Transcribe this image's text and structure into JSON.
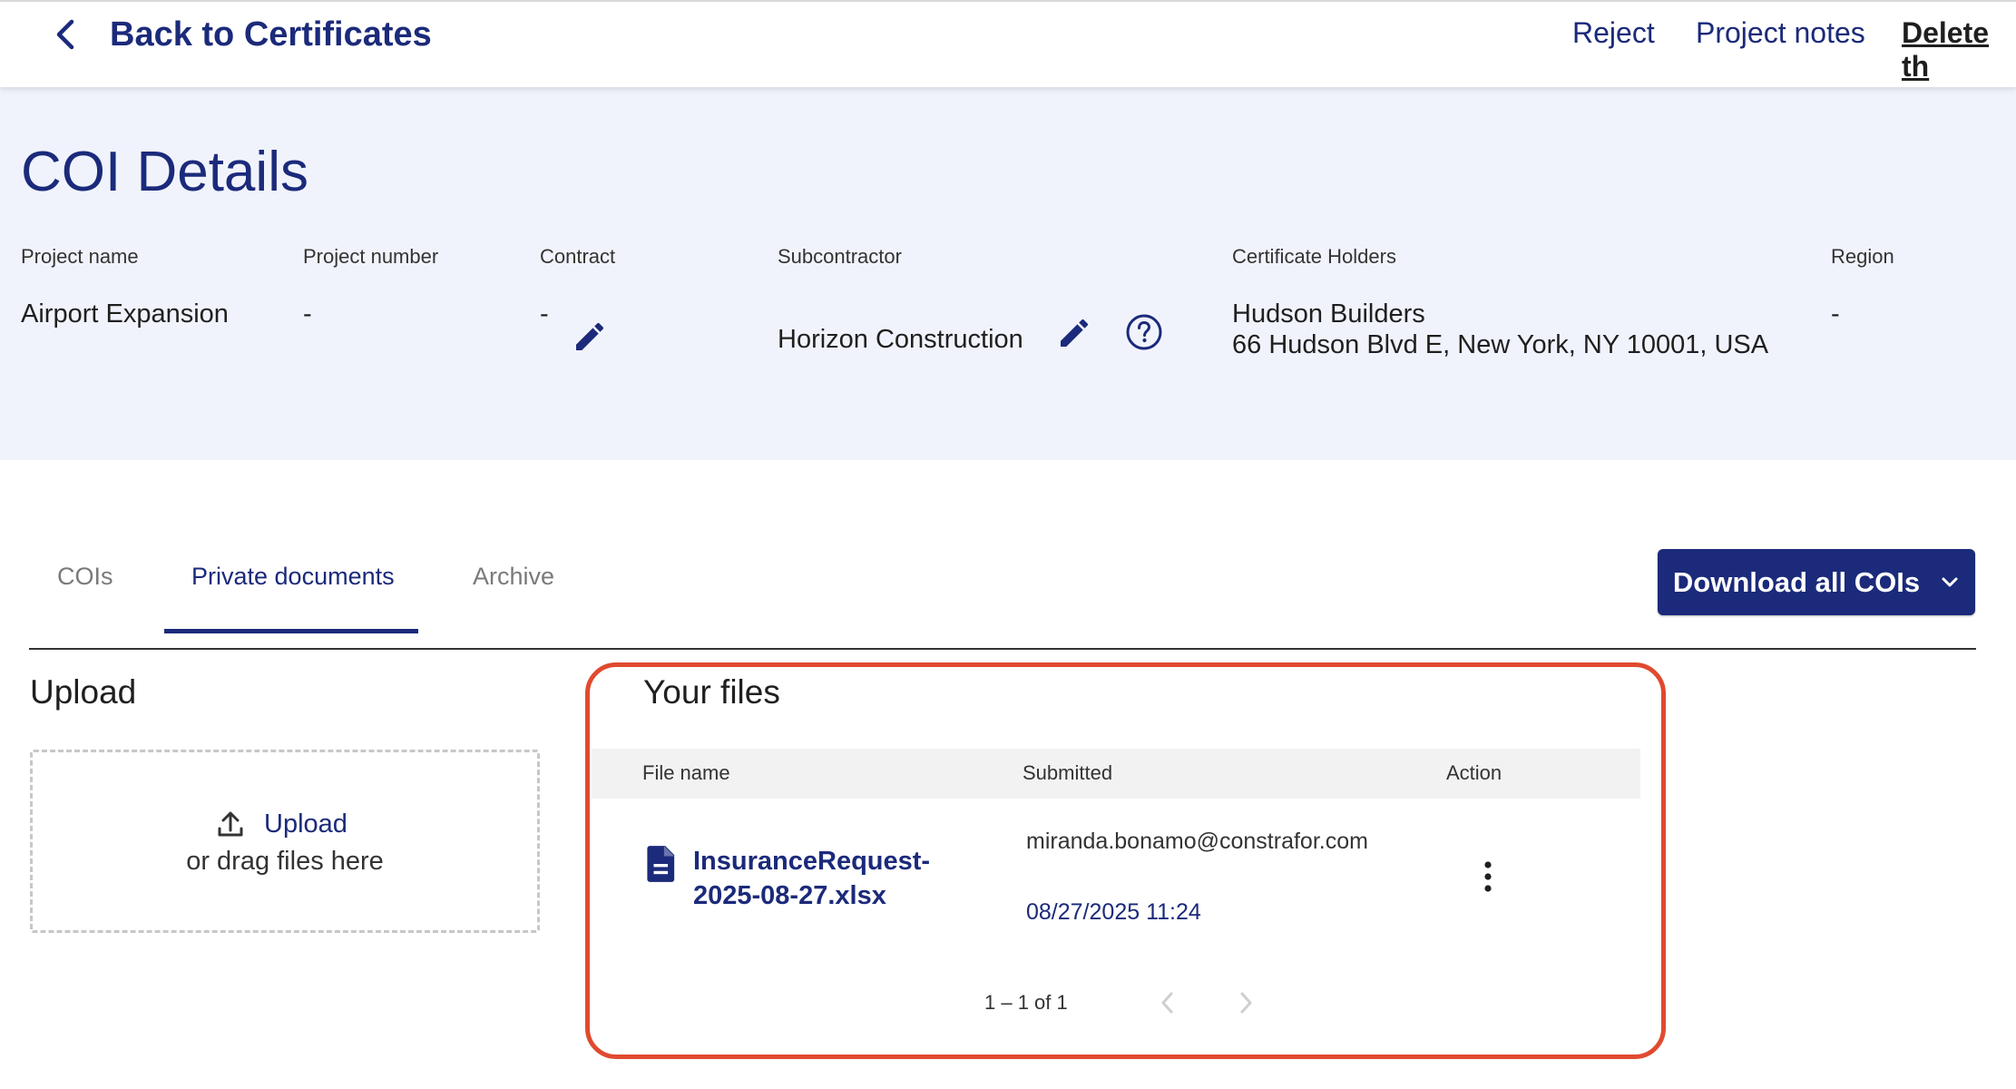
{
  "topbar": {
    "back_label": "Back to Certificates",
    "reject_label": "Reject",
    "project_notes_label": "Project notes",
    "delete_label": "Delete th"
  },
  "header": {
    "title": "COI Details",
    "fields": {
      "project_name": {
        "label": "Project name",
        "value": "Airport Expansion"
      },
      "project_number": {
        "label": "Project number",
        "value": "-"
      },
      "contract": {
        "label": "Contract",
        "value": "-"
      },
      "subcontractor": {
        "label": "Subcontractor",
        "value": "Horizon Construction"
      },
      "certificate_holders": {
        "label": "Certificate Holders",
        "name": "Hudson Builders",
        "address": "66 Hudson Blvd E, New York, NY 10001, USA"
      },
      "region": {
        "label": "Region",
        "value": "-"
      }
    }
  },
  "tabs": [
    {
      "label": "COIs",
      "active": false
    },
    {
      "label": "Private documents",
      "active": true
    },
    {
      "label": "Archive",
      "active": false
    }
  ],
  "download_button": {
    "label": "Download all COIs"
  },
  "upload": {
    "title": "Upload",
    "link_label": "Upload",
    "hint": "or drag files here"
  },
  "files": {
    "title": "Your files",
    "columns": [
      "File name",
      "Submitted",
      "Action"
    ],
    "rows": [
      {
        "file_name_line1": "InsuranceRequest-",
        "file_name_line2": "2025-08-27.xlsx",
        "submitted_by": "miranda.bonamo@constrafor.com",
        "submitted_at": "08/27/2025 11:24"
      }
    ],
    "pagination": "1 – 1 of 1"
  },
  "colors": {
    "brand_navy": "#1b2a7a",
    "header_band": "#f1f3fc",
    "highlight_border": "#e04a2f"
  },
  "icons": [
    "chevron-left-icon",
    "pencil-icon",
    "help-circle-icon",
    "chevron-down-icon",
    "upload-icon",
    "document-icon",
    "more-vertical-icon"
  ]
}
